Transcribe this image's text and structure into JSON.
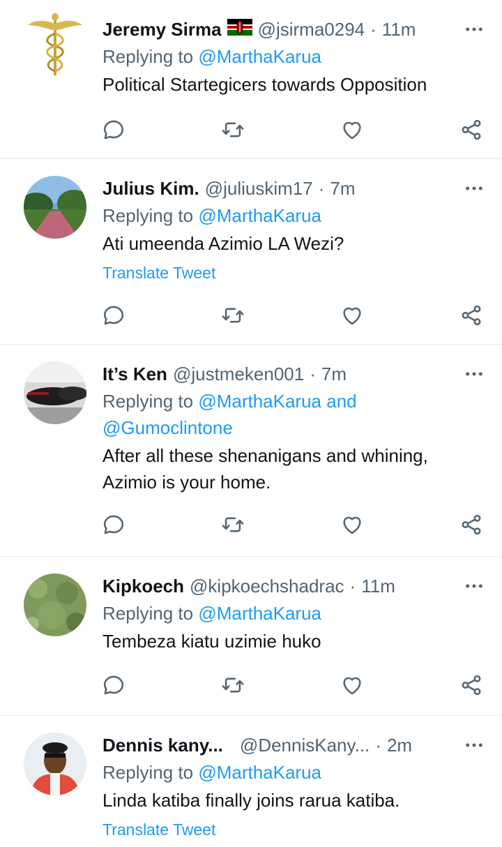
{
  "tweets": [
    {
      "name": "Jeremy Sirma",
      "flag": "kenya-flag",
      "handle": "@jsirma0294",
      "separator": "·",
      "time": "11m",
      "replying_prefix": "Replying to",
      "replying_to": "@MarthaKarua",
      "text": "Political Startegicers towards Opposition",
      "translate": ""
    },
    {
      "name": "Julius Kim.",
      "handle": "@juliuskim17",
      "separator": "·",
      "time": "7m",
      "replying_prefix": "Replying to",
      "replying_to": "@MarthaKarua",
      "text": "Ati umeenda Azimio LA Wezi?",
      "translate": "Translate Tweet"
    },
    {
      "name": "It’s Ken",
      "handle": "@justmeken001",
      "separator": "·",
      "time": "7m",
      "replying_prefix": "Replying to",
      "replying_to": "@MarthaKarua and",
      "replying_to_2": "@Gumoclintone",
      "text_line1": "After all these shenanigans and whining,",
      "text_line2": "Azimio is your home.",
      "translate": ""
    },
    {
      "name": "Kipkoech",
      "handle": "@kipkoechshadrac",
      "separator": "·",
      "time": "11m",
      "replying_prefix": "Replying to",
      "replying_to": "@MarthaKarua",
      "text": "Tembeza kiatu uzimie huko",
      "translate": ""
    },
    {
      "name": "Dennis kany...",
      "handle": "@DennisKany...",
      "separator": "·",
      "time": "2m",
      "replying_prefix": "Replying to",
      "replying_to": "@MarthaKarua",
      "text": "Linda katiba finally joins rarua katiba.",
      "translate": "Translate Tweet"
    }
  ],
  "icons": {
    "reply": "reply-icon",
    "retweet": "retweet-icon",
    "like": "heart-icon",
    "share": "share-icon",
    "more": "more-options-icon"
  },
  "colors": {
    "accent": "#1d9bf0",
    "secondary_text": "#536471",
    "primary_text": "#0f1419",
    "divider": "#e6ecf0"
  }
}
